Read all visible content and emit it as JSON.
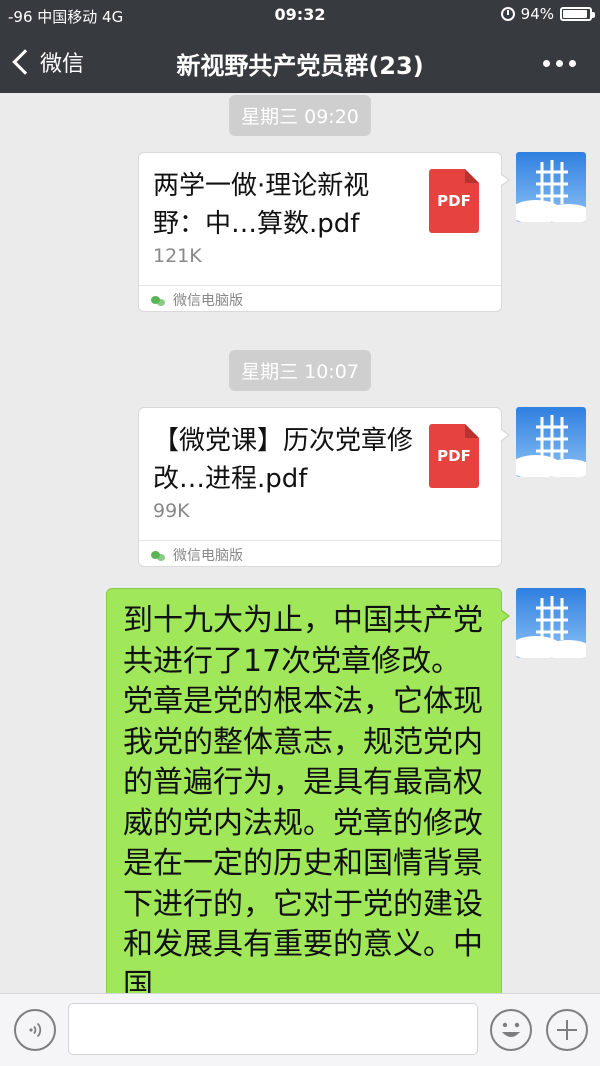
{
  "status_bar": {
    "carrier": "-96 中国移动  4G",
    "time": "09:32",
    "battery": "94%",
    "battery_level": 0.94,
    "icons": [
      "alarm-icon",
      "battery-icon"
    ]
  },
  "nav": {
    "back_label": "微信",
    "title": "新视野共产党员群(23)",
    "icons": [
      "chevron-left-icon",
      "more-icon"
    ]
  },
  "messages": [
    {
      "type": "timestamp",
      "text": "星期三 09:20"
    },
    {
      "type": "file",
      "name": "两学一做·理论新视野：中…算数.pdf",
      "size": "121K",
      "file_type": "PDF",
      "source": "微信电脑版",
      "icon": "pdf-icon"
    },
    {
      "type": "timestamp",
      "text": "星期三 10:07"
    },
    {
      "type": "file",
      "name": "【微党课】历次党章修改…进程.pdf",
      "size": "99K",
      "file_type": "PDF",
      "source": "微信电脑版",
      "icon": "pdf-icon"
    },
    {
      "type": "text",
      "text": "到十九大为止，中国共产党共进行了17次党章修改。党章是党的根本法，它体现我党的整体意志，规范党内的普遍行为，是具有最高权威的党内法规。党章的修改是在一定的历史和国情背景下进行的，它对于党的建设和发展具有重要的意义。中国"
    }
  ],
  "input_bar": {
    "placeholder": "",
    "icons": [
      "voice-icon",
      "emoji-icon",
      "plus-icon"
    ]
  },
  "colors": {
    "nav_bg": "#373a3f",
    "chat_bg": "#ebebeb",
    "own_bubble": "#a0e75a",
    "pdf_red": "#e64340",
    "timestamp_bg": "#cfcfcf"
  }
}
